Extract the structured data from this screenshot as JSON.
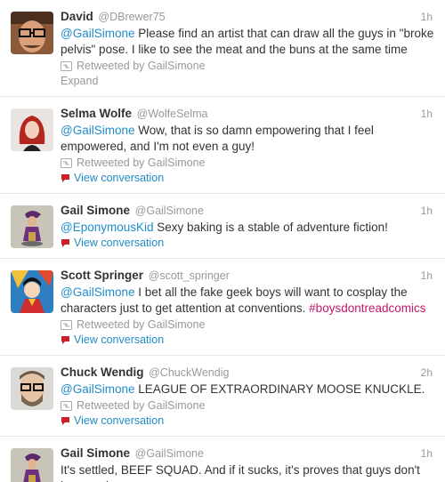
{
  "tweets": [
    {
      "fullname": "David",
      "username": "@DBrewer75",
      "time": "1h",
      "text_parts": [
        {
          "type": "mention",
          "text": "@GailSimone"
        },
        {
          "type": "text",
          "text": " Please find an artist that can draw all the guys in \"broke pelvis\" pose. I like to see the meat and the buns at the same time"
        }
      ],
      "retweeted_by": "Retweeted by GailSimone",
      "action": "Expand",
      "avatar_icon": "user-avatar-glasses"
    },
    {
      "fullname": "Selma Wolfe",
      "username": "@WolfeSelma",
      "time": "1h",
      "text_parts": [
        {
          "type": "mention",
          "text": "@GailSimone"
        },
        {
          "type": "text",
          "text": " Wow, that is so damn empowering that I feel empowered, and I'm not even a guy!"
        }
      ],
      "retweeted_by": "Retweeted by GailSimone",
      "action": "View conversation",
      "avatar_icon": "user-avatar-redhead"
    },
    {
      "fullname": "Gail Simone",
      "username": "@GailSimone",
      "time": "1h",
      "text_parts": [
        {
          "type": "mention",
          "text": "@EponymousKid"
        },
        {
          "type": "text",
          "text": " Sexy baking is a stable of adventure fiction!"
        }
      ],
      "retweeted_by": null,
      "action": "View conversation",
      "avatar_icon": "user-avatar-figurine"
    },
    {
      "fullname": "Scott Springer",
      "username": "@scott_springer",
      "time": "1h",
      "text_parts": [
        {
          "type": "mention",
          "text": "@GailSimone"
        },
        {
          "type": "text",
          "text": " I bet all the fake geek boys will want to cosplay the characters just to get attention at conventions.  "
        },
        {
          "type": "hashtag",
          "text": "#boysdontreadcomics"
        }
      ],
      "retweeted_by": "Retweeted by GailSimone",
      "action": "View conversation",
      "avatar_icon": "user-avatar-comic"
    },
    {
      "fullname": "Chuck Wendig",
      "username": "@ChuckWendig",
      "time": "2h",
      "text_parts": [
        {
          "type": "mention",
          "text": "@GailSimone"
        },
        {
          "type": "text",
          "text": " LEAGUE OF EXTRAORDINARY MOOSE KNUCKLE."
        }
      ],
      "retweeted_by": "Retweeted by GailSimone",
      "action": "View conversation",
      "avatar_icon": "user-avatar-beard-glasses"
    },
    {
      "fullname": "Gail Simone",
      "username": "@GailSimone",
      "time": "1h",
      "text_parts": [
        {
          "type": "text",
          "text": "It's settled, BEEF SQUAD. And if it sucks, it's proves that guys don't buy comics."
        }
      ],
      "retweeted_by": null,
      "action": null,
      "avatar_icon": "user-avatar-figurine"
    }
  ],
  "colors": {
    "link": "#1f8cc9",
    "hashtag": "#c2186a",
    "muted": "#999999",
    "conversation_icon": "#cc1f27"
  }
}
